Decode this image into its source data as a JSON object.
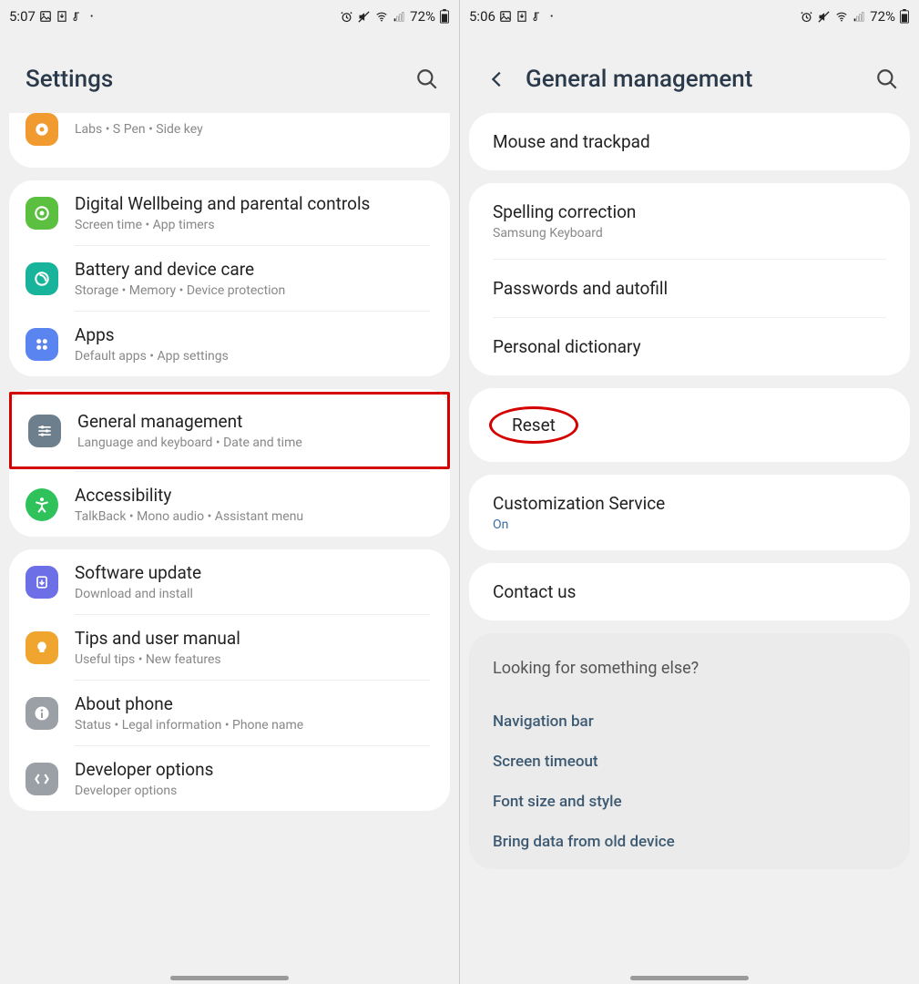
{
  "left": {
    "status": {
      "time": "5:07",
      "battery": "72%"
    },
    "header": {
      "title": "Settings"
    },
    "group0": {
      "sub": "Labs  •  S Pen  •  Side key"
    },
    "group1": {
      "items": [
        {
          "title": "Digital Wellbeing and parental controls",
          "sub": "Screen time  •  App timers",
          "icon": "wellbeing",
          "color": "#5bbf3f"
        },
        {
          "title": "Battery and device care",
          "sub": "Storage  •  Memory  •  Device protection",
          "icon": "care",
          "color": "#17b39a"
        },
        {
          "title": "Apps",
          "sub": "Default apps  •  App settings",
          "icon": "apps",
          "color": "#5a84f0"
        }
      ]
    },
    "group2": {
      "items": [
        {
          "title": "General management",
          "sub": "Language and keyboard  •  Date and time",
          "icon": "gm",
          "color": "#6d7f8c",
          "highlight": true
        },
        {
          "title": "Accessibility",
          "sub": "TalkBack  •  Mono audio  •  Assistant menu",
          "icon": "a11y",
          "color": "#2fc25a"
        }
      ]
    },
    "group3": {
      "items": [
        {
          "title": "Software update",
          "sub": "Download and install",
          "icon": "sw",
          "color": "#6c6fe6"
        },
        {
          "title": "Tips and user manual",
          "sub": "Useful tips  •  New features",
          "icon": "tips",
          "color": "#f0a52f"
        },
        {
          "title": "About phone",
          "sub": "Status  •  Legal information  •  Phone name",
          "icon": "about",
          "color": "#9aa0a5"
        },
        {
          "title": "Developer options",
          "sub": "Developer options",
          "icon": "dev",
          "color": "#9aa0a5"
        }
      ]
    }
  },
  "right": {
    "status": {
      "time": "5:06",
      "battery": "72%"
    },
    "header": {
      "title": "General management"
    },
    "group0": {
      "items": [
        {
          "title": "Mouse and trackpad"
        }
      ]
    },
    "group1": {
      "items": [
        {
          "title": "Spelling correction",
          "sub": "Samsung Keyboard"
        },
        {
          "title": "Passwords and autofill"
        },
        {
          "title": "Personal dictionary"
        }
      ]
    },
    "group2": {
      "items": [
        {
          "title": "Reset",
          "circled": true
        }
      ]
    },
    "group3": {
      "items": [
        {
          "title": "Customization Service",
          "sub": "On",
          "value": true
        }
      ]
    },
    "group4": {
      "items": [
        {
          "title": "Contact us"
        }
      ]
    },
    "suggestions": {
      "heading": "Looking for something else?",
      "links": [
        "Navigation bar",
        "Screen timeout",
        "Font size and style",
        "Bring data from old device"
      ]
    }
  }
}
